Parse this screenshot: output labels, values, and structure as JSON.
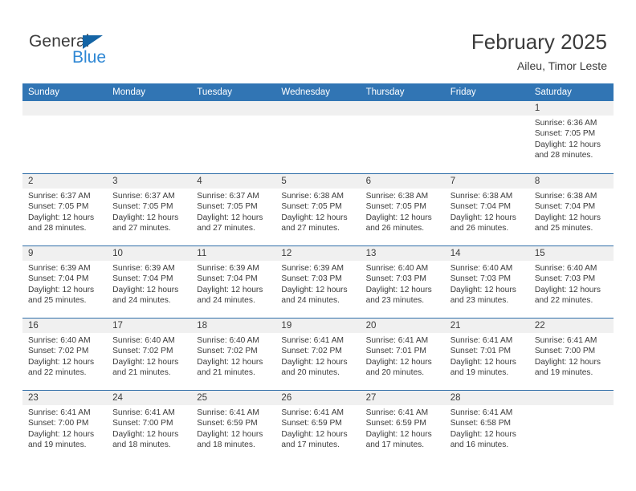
{
  "logo": {
    "word1": "General",
    "word2": "Blue",
    "triangle_color": "#1464a5",
    "blue_color": "#2e87d4"
  },
  "header": {
    "title": "February 2025",
    "subtitle": "Aileu, Timor Leste",
    "header_bg": "#3175b4",
    "band_bg": "#f0f0f0"
  },
  "weekdays": [
    {
      "label": "Sunday"
    },
    {
      "label": "Monday"
    },
    {
      "label": "Tuesday"
    },
    {
      "label": "Wednesday"
    },
    {
      "label": "Thursday"
    },
    {
      "label": "Friday"
    },
    {
      "label": "Saturday"
    }
  ],
  "weeks": [
    {
      "days": [
        {
          "num": "",
          "sunrise": "",
          "sunset": "",
          "daylight1": "",
          "daylight2": "",
          "empty": true
        },
        {
          "num": "",
          "sunrise": "",
          "sunset": "",
          "daylight1": "",
          "daylight2": "",
          "empty": true
        },
        {
          "num": "",
          "sunrise": "",
          "sunset": "",
          "daylight1": "",
          "daylight2": "",
          "empty": true
        },
        {
          "num": "",
          "sunrise": "",
          "sunset": "",
          "daylight1": "",
          "daylight2": "",
          "empty": true
        },
        {
          "num": "",
          "sunrise": "",
          "sunset": "",
          "daylight1": "",
          "daylight2": "",
          "empty": true
        },
        {
          "num": "",
          "sunrise": "",
          "sunset": "",
          "daylight1": "",
          "daylight2": "",
          "empty": true
        },
        {
          "num": "1",
          "sunrise": "Sunrise: 6:36 AM",
          "sunset": "Sunset: 7:05 PM",
          "daylight1": "Daylight: 12 hours",
          "daylight2": "and 28 minutes.",
          "empty": false
        }
      ]
    },
    {
      "days": [
        {
          "num": "2",
          "sunrise": "Sunrise: 6:37 AM",
          "sunset": "Sunset: 7:05 PM",
          "daylight1": "Daylight: 12 hours",
          "daylight2": "and 28 minutes.",
          "empty": false
        },
        {
          "num": "3",
          "sunrise": "Sunrise: 6:37 AM",
          "sunset": "Sunset: 7:05 PM",
          "daylight1": "Daylight: 12 hours",
          "daylight2": "and 27 minutes.",
          "empty": false
        },
        {
          "num": "4",
          "sunrise": "Sunrise: 6:37 AM",
          "sunset": "Sunset: 7:05 PM",
          "daylight1": "Daylight: 12 hours",
          "daylight2": "and 27 minutes.",
          "empty": false
        },
        {
          "num": "5",
          "sunrise": "Sunrise: 6:38 AM",
          "sunset": "Sunset: 7:05 PM",
          "daylight1": "Daylight: 12 hours",
          "daylight2": "and 27 minutes.",
          "empty": false
        },
        {
          "num": "6",
          "sunrise": "Sunrise: 6:38 AM",
          "sunset": "Sunset: 7:05 PM",
          "daylight1": "Daylight: 12 hours",
          "daylight2": "and 26 minutes.",
          "empty": false
        },
        {
          "num": "7",
          "sunrise": "Sunrise: 6:38 AM",
          "sunset": "Sunset: 7:04 PM",
          "daylight1": "Daylight: 12 hours",
          "daylight2": "and 26 minutes.",
          "empty": false
        },
        {
          "num": "8",
          "sunrise": "Sunrise: 6:38 AM",
          "sunset": "Sunset: 7:04 PM",
          "daylight1": "Daylight: 12 hours",
          "daylight2": "and 25 minutes.",
          "empty": false
        }
      ]
    },
    {
      "days": [
        {
          "num": "9",
          "sunrise": "Sunrise: 6:39 AM",
          "sunset": "Sunset: 7:04 PM",
          "daylight1": "Daylight: 12 hours",
          "daylight2": "and 25 minutes.",
          "empty": false
        },
        {
          "num": "10",
          "sunrise": "Sunrise: 6:39 AM",
          "sunset": "Sunset: 7:04 PM",
          "daylight1": "Daylight: 12 hours",
          "daylight2": "and 24 minutes.",
          "empty": false
        },
        {
          "num": "11",
          "sunrise": "Sunrise: 6:39 AM",
          "sunset": "Sunset: 7:04 PM",
          "daylight1": "Daylight: 12 hours",
          "daylight2": "and 24 minutes.",
          "empty": false
        },
        {
          "num": "12",
          "sunrise": "Sunrise: 6:39 AM",
          "sunset": "Sunset: 7:03 PM",
          "daylight1": "Daylight: 12 hours",
          "daylight2": "and 24 minutes.",
          "empty": false
        },
        {
          "num": "13",
          "sunrise": "Sunrise: 6:40 AM",
          "sunset": "Sunset: 7:03 PM",
          "daylight1": "Daylight: 12 hours",
          "daylight2": "and 23 minutes.",
          "empty": false
        },
        {
          "num": "14",
          "sunrise": "Sunrise: 6:40 AM",
          "sunset": "Sunset: 7:03 PM",
          "daylight1": "Daylight: 12 hours",
          "daylight2": "and 23 minutes.",
          "empty": false
        },
        {
          "num": "15",
          "sunrise": "Sunrise: 6:40 AM",
          "sunset": "Sunset: 7:03 PM",
          "daylight1": "Daylight: 12 hours",
          "daylight2": "and 22 minutes.",
          "empty": false
        }
      ]
    },
    {
      "days": [
        {
          "num": "16",
          "sunrise": "Sunrise: 6:40 AM",
          "sunset": "Sunset: 7:02 PM",
          "daylight1": "Daylight: 12 hours",
          "daylight2": "and 22 minutes.",
          "empty": false
        },
        {
          "num": "17",
          "sunrise": "Sunrise: 6:40 AM",
          "sunset": "Sunset: 7:02 PM",
          "daylight1": "Daylight: 12 hours",
          "daylight2": "and 21 minutes.",
          "empty": false
        },
        {
          "num": "18",
          "sunrise": "Sunrise: 6:40 AM",
          "sunset": "Sunset: 7:02 PM",
          "daylight1": "Daylight: 12 hours",
          "daylight2": "and 21 minutes.",
          "empty": false
        },
        {
          "num": "19",
          "sunrise": "Sunrise: 6:41 AM",
          "sunset": "Sunset: 7:02 PM",
          "daylight1": "Daylight: 12 hours",
          "daylight2": "and 20 minutes.",
          "empty": false
        },
        {
          "num": "20",
          "sunrise": "Sunrise: 6:41 AM",
          "sunset": "Sunset: 7:01 PM",
          "daylight1": "Daylight: 12 hours",
          "daylight2": "and 20 minutes.",
          "empty": false
        },
        {
          "num": "21",
          "sunrise": "Sunrise: 6:41 AM",
          "sunset": "Sunset: 7:01 PM",
          "daylight1": "Daylight: 12 hours",
          "daylight2": "and 19 minutes.",
          "empty": false
        },
        {
          "num": "22",
          "sunrise": "Sunrise: 6:41 AM",
          "sunset": "Sunset: 7:00 PM",
          "daylight1": "Daylight: 12 hours",
          "daylight2": "and 19 minutes.",
          "empty": false
        }
      ]
    },
    {
      "days": [
        {
          "num": "23",
          "sunrise": "Sunrise: 6:41 AM",
          "sunset": "Sunset: 7:00 PM",
          "daylight1": "Daylight: 12 hours",
          "daylight2": "and 19 minutes.",
          "empty": false
        },
        {
          "num": "24",
          "sunrise": "Sunrise: 6:41 AM",
          "sunset": "Sunset: 7:00 PM",
          "daylight1": "Daylight: 12 hours",
          "daylight2": "and 18 minutes.",
          "empty": false
        },
        {
          "num": "25",
          "sunrise": "Sunrise: 6:41 AM",
          "sunset": "Sunset: 6:59 PM",
          "daylight1": "Daylight: 12 hours",
          "daylight2": "and 18 minutes.",
          "empty": false
        },
        {
          "num": "26",
          "sunrise": "Sunrise: 6:41 AM",
          "sunset": "Sunset: 6:59 PM",
          "daylight1": "Daylight: 12 hours",
          "daylight2": "and 17 minutes.",
          "empty": false
        },
        {
          "num": "27",
          "sunrise": "Sunrise: 6:41 AM",
          "sunset": "Sunset: 6:59 PM",
          "daylight1": "Daylight: 12 hours",
          "daylight2": "and 17 minutes.",
          "empty": false
        },
        {
          "num": "28",
          "sunrise": "Sunrise: 6:41 AM",
          "sunset": "Sunset: 6:58 PM",
          "daylight1": "Daylight: 12 hours",
          "daylight2": "and 16 minutes.",
          "empty": false
        },
        {
          "num": "",
          "sunrise": "",
          "sunset": "",
          "daylight1": "",
          "daylight2": "",
          "empty": true
        }
      ]
    }
  ]
}
